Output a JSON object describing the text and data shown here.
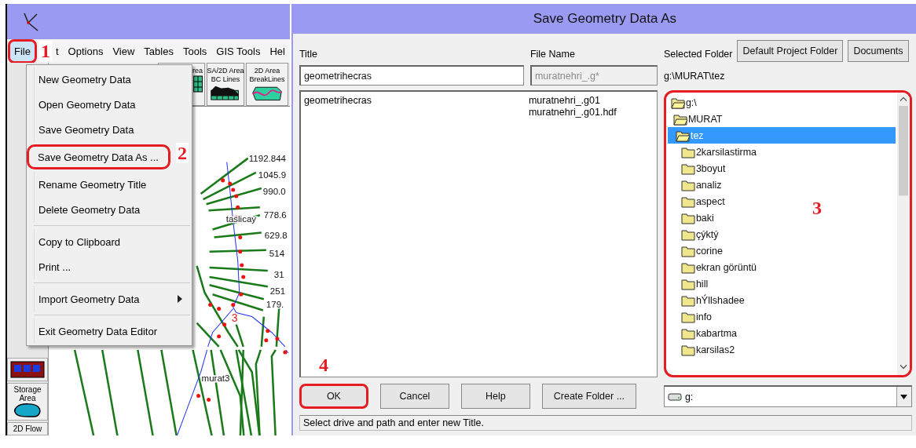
{
  "app_window": {
    "menu": [
      {
        "label": "File",
        "selected": true,
        "highlighted": true
      },
      {
        "label": "t",
        "selected": false,
        "highlighted": false
      },
      {
        "label": "Options",
        "selected": false,
        "highlighted": false
      },
      {
        "label": "View",
        "selected": false,
        "highlighted": false
      },
      {
        "label": "Tables",
        "selected": false,
        "highlighted": false
      },
      {
        "label": "Tools",
        "selected": false,
        "highlighted": false
      },
      {
        "label": "GIS Tools",
        "selected": false,
        "highlighted": false
      },
      {
        "label": "Hel",
        "selected": false,
        "highlighted": false
      }
    ],
    "toolbar": [
      {
        "kind": "grid",
        "lines": [
          "rea"
        ]
      },
      {
        "kind": "bc-lines",
        "lines": [
          "SA/2D Area",
          "BC Lines"
        ]
      },
      {
        "kind": "breaklines",
        "lines": [
          "2D Area",
          "BreakLines"
        ]
      }
    ],
    "palette": [
      {
        "kind": "junction"
      },
      {
        "kind": "storage",
        "label": "Storage Area"
      },
      {
        "kind": "flow2d",
        "label": "2D Flow"
      }
    ],
    "map_labels": [
      {
        "text": "1192.844"
      },
      {
        "text": "1045.9"
      },
      {
        "text": "990.0"
      },
      {
        "text": "taslicay"
      },
      {
        "text": "778.6"
      },
      {
        "text": "629.8"
      },
      {
        "text": "514"
      },
      {
        "text": "31"
      },
      {
        "text": "251"
      },
      {
        "text": "179."
      },
      {
        "text": "3"
      },
      {
        "text": "murat3"
      }
    ],
    "file_menu": [
      {
        "kind": "item",
        "label": "New Geometry Data",
        "submenu": false,
        "highlighted": false
      },
      {
        "kind": "item",
        "label": "Open Geometry Data",
        "submenu": false,
        "highlighted": false
      },
      {
        "kind": "item",
        "label": "Save Geometry Data",
        "submenu": false,
        "highlighted": false
      },
      {
        "kind": "item",
        "label": "Save Geometry Data As ...",
        "submenu": false,
        "highlighted": true
      },
      {
        "kind": "item",
        "label": "Rename Geometry Title",
        "submenu": false,
        "highlighted": false
      },
      {
        "kind": "item",
        "label": "Delete Geometry Data",
        "submenu": false,
        "highlighted": false
      },
      {
        "kind": "separator"
      },
      {
        "kind": "item",
        "label": "Copy to Clipboard",
        "submenu": false,
        "highlighted": false
      },
      {
        "kind": "item",
        "label": "Print ...",
        "submenu": false,
        "highlighted": false
      },
      {
        "kind": "separator"
      },
      {
        "kind": "item",
        "label": "Import Geometry Data",
        "submenu": true,
        "highlighted": false
      },
      {
        "kind": "separator"
      },
      {
        "kind": "item",
        "label": "Exit Geometry Data Editor",
        "submenu": false,
        "highlighted": false
      }
    ]
  },
  "dialog": {
    "title": "Save Geometry Data As",
    "title_label": "Title",
    "title_value": "geometrihecras",
    "file_name_label": "File Name",
    "file_name_value": "muratnehri_.g*",
    "file_name_disabled": true,
    "selected_folder_label": "Selected Folder",
    "folder_buttons": [
      "Default Project Folder",
      "Documents"
    ],
    "selected_path": "g:\\MURAT\\tez",
    "geometry_list": [
      {
        "title": "geometrihecras",
        "files": [
          "muratnehri_.g01",
          "muratnehri_.g01.hdf"
        ]
      }
    ],
    "folder_tree_highlighted": true,
    "folder_tree": [
      {
        "name": "g:\\",
        "selected": false,
        "children": [
          {
            "name": "MURAT",
            "selected": false,
            "children": [
              {
                "name": "tez",
                "selected": true,
                "children": [
                  {
                    "name": "2karsilastirma",
                    "selected": false
                  },
                  {
                    "name": "3boyut",
                    "selected": false
                  },
                  {
                    "name": "analiz",
                    "selected": false
                  },
                  {
                    "name": "aspect",
                    "selected": false
                  },
                  {
                    "name": "baki",
                    "selected": false
                  },
                  {
                    "name": "çýktý",
                    "selected": false
                  },
                  {
                    "name": "corine",
                    "selected": false
                  },
                  {
                    "name": "ekran görüntü",
                    "selected": false
                  },
                  {
                    "name": "hill",
                    "selected": false
                  },
                  {
                    "name": "hÝllshadee",
                    "selected": false
                  },
                  {
                    "name": "info",
                    "selected": false
                  },
                  {
                    "name": "kabartma",
                    "selected": false
                  },
                  {
                    "name": "karsilas2",
                    "selected": false
                  }
                ]
              }
            ]
          }
        ]
      }
    ],
    "drive": "g:",
    "buttons": [
      {
        "label": "OK",
        "highlighted": true
      },
      {
        "label": "Cancel",
        "highlighted": false
      },
      {
        "label": "Help",
        "highlighted": false
      },
      {
        "label": "Create Folder ...",
        "highlighted": false
      }
    ],
    "status": "Select drive and path and enter new Title."
  },
  "annotations": [
    {
      "label": "1"
    },
    {
      "label": "2"
    },
    {
      "label": "3"
    },
    {
      "label": "4"
    }
  ]
}
